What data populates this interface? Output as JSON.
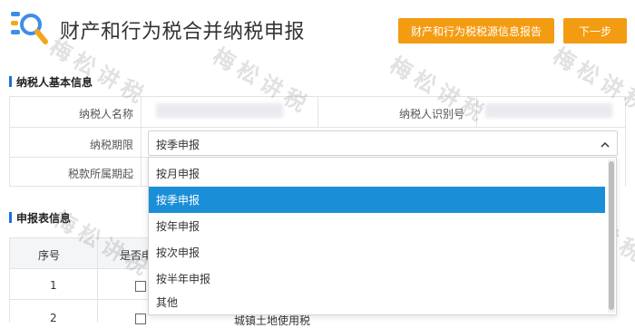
{
  "header": {
    "title": "财产和行为税合并纳税申报",
    "report_button": "财产和行为税税源信息报告",
    "next_button": "下一步"
  },
  "basic_info": {
    "section_title": "纳税人基本信息",
    "taxpayer_name_label": "纳税人名称",
    "taxpayer_id_label": "纳税人识别号",
    "period_label": "纳税期限",
    "tax_period_label": "税款所属期起",
    "period_selected": "按季申报"
  },
  "dropdown": {
    "options": [
      "按月申报",
      "按季申报",
      "按年申报",
      "按次申报",
      "按半年申报",
      "其他"
    ],
    "selected_index": 1
  },
  "declaration": {
    "section_title": "申报表信息",
    "columns": [
      "序号",
      "是否申"
    ],
    "rows": [
      {
        "no": "1",
        "text": ""
      },
      {
        "no": "2",
        "text": "城镇土地使用税"
      }
    ]
  },
  "watermark": "梅松讲税",
  "colors": {
    "accent_orange": "#f39c12",
    "selected_blue": "#1a8fd8",
    "section_bar": "#1e6fd8"
  }
}
